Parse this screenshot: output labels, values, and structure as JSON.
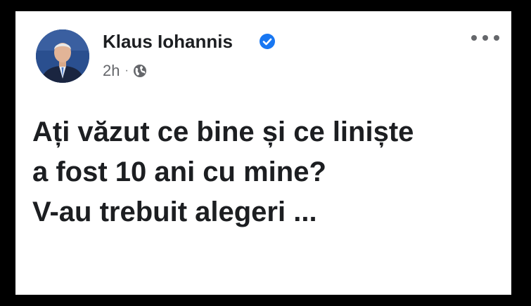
{
  "post": {
    "author": "Klaus Iohannis",
    "verified_icon": "verified-badge-icon",
    "timestamp": "2h",
    "separator": "·",
    "audience_icon": "globe-icon",
    "more_icon": "more-options-icon",
    "lines": [
      "Ați văzut ce bine și ce liniște",
      "a fost 10 ani cu mine?",
      "V-au trebuit alegeri ..."
    ]
  },
  "colors": {
    "background": "#000000",
    "card": "#ffffff",
    "text": "#1c1e21",
    "secondary": "#65676b",
    "verified": "#1877f2"
  }
}
